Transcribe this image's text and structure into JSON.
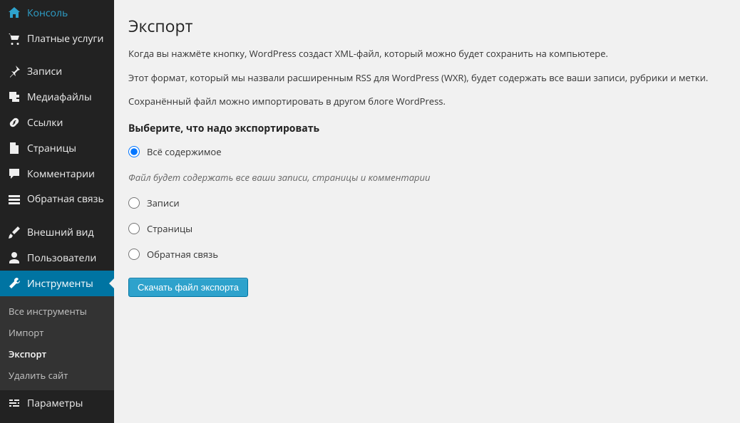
{
  "sidebar": {
    "items": [
      {
        "label": "Консоль"
      },
      {
        "label": "Платные услуги"
      },
      {
        "label": "Записи"
      },
      {
        "label": "Медиафайлы"
      },
      {
        "label": "Ссылки"
      },
      {
        "label": "Страницы"
      },
      {
        "label": "Комментарии"
      },
      {
        "label": "Обратная связь"
      },
      {
        "label": "Внешний вид"
      },
      {
        "label": "Пользователи"
      },
      {
        "label": "Инструменты"
      },
      {
        "label": "Параметры"
      }
    ],
    "submenu": [
      {
        "label": "Все инструменты"
      },
      {
        "label": "Импорт"
      },
      {
        "label": "Экспорт"
      },
      {
        "label": "Удалить сайт"
      }
    ]
  },
  "main": {
    "title": "Экспорт",
    "desc1": "Когда вы нажмёте кнопку, WordPress создаст XML-файл, который можно будет сохранить на компьютере.",
    "desc2": "Этот формат, который мы назвали расширенным RSS для WordPress (WXR), будет содержать все ваши записи, рубрики и метки.",
    "desc3": "Сохранённый файл можно импортировать в другом блоге WordPress.",
    "section_heading": "Выберите, что надо экспортировать",
    "options": [
      {
        "label": "Всё содержимое"
      },
      {
        "label": "Записи"
      },
      {
        "label": "Страницы"
      },
      {
        "label": "Обратная связь"
      }
    ],
    "hint": "Файл будет содержать все ваши записи, страницы и комментарии",
    "button": "Скачать файл экспорта"
  }
}
